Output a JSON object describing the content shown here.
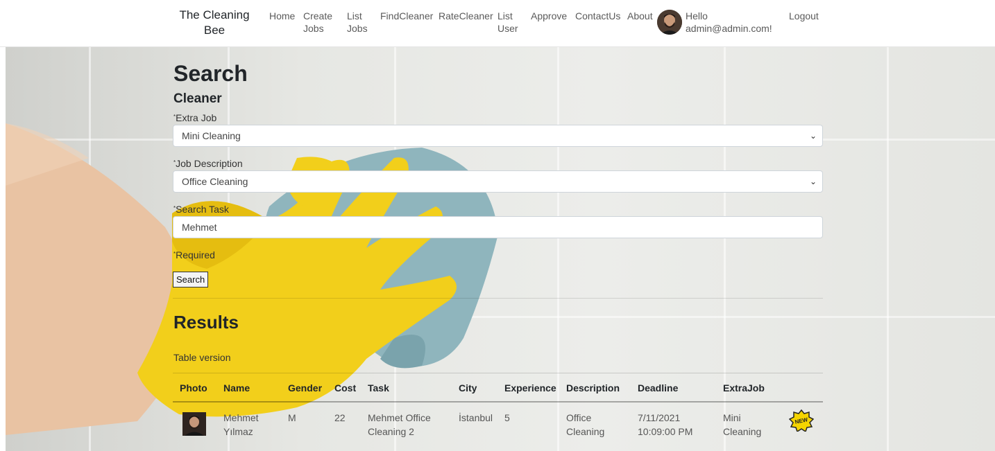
{
  "navbar": {
    "brand": "The Cleaning Bee",
    "items": [
      {
        "label": "Home"
      },
      {
        "label": "Create Jobs"
      },
      {
        "label": "List Jobs"
      },
      {
        "label": "FindCleaner"
      },
      {
        "label": "RateCleaner"
      },
      {
        "label": "List User"
      },
      {
        "label": "Approve"
      },
      {
        "label": "ContactUs"
      },
      {
        "label": "About"
      }
    ],
    "greeting": "Hello admin@admin.com!",
    "logout": "Logout"
  },
  "search": {
    "title": "Search",
    "subtitle": "Cleaner",
    "extra_job_label": "Extra Job",
    "extra_job_value": "Mini Cleaning",
    "job_description_label": "Job Description",
    "job_description_value": "Office Cleaning",
    "search_task_label": "Search Task",
    "search_task_value": "Mehmet",
    "required_label": "Required",
    "required_mark": "*",
    "search_button": "Search"
  },
  "results": {
    "title": "Results",
    "caption": "Table version",
    "columns": [
      "Photo",
      "Name",
      "Gender",
      "Cost",
      "Task",
      "City",
      "Experience",
      "Description",
      "Deadline",
      "ExtraJob"
    ],
    "rows": [
      {
        "name": "Mehmet Yılmaz",
        "gender": "M",
        "cost": "22",
        "task": "Mehmet Office Cleaning 2",
        "city": "İstanbul",
        "experience": "5",
        "description": "Office Cleaning",
        "deadline": "7/11/2021 10:09:00 PM",
        "extra_job": "Mini Cleaning",
        "badge": "NEW"
      }
    ]
  },
  "colors": {
    "badge_fill": "#f5d400",
    "text": "#212529",
    "nav_text": "#5a5a5a"
  },
  "icons": {
    "select_arrow": "chevron-down-icon",
    "new_badge": "new-badge-icon"
  }
}
